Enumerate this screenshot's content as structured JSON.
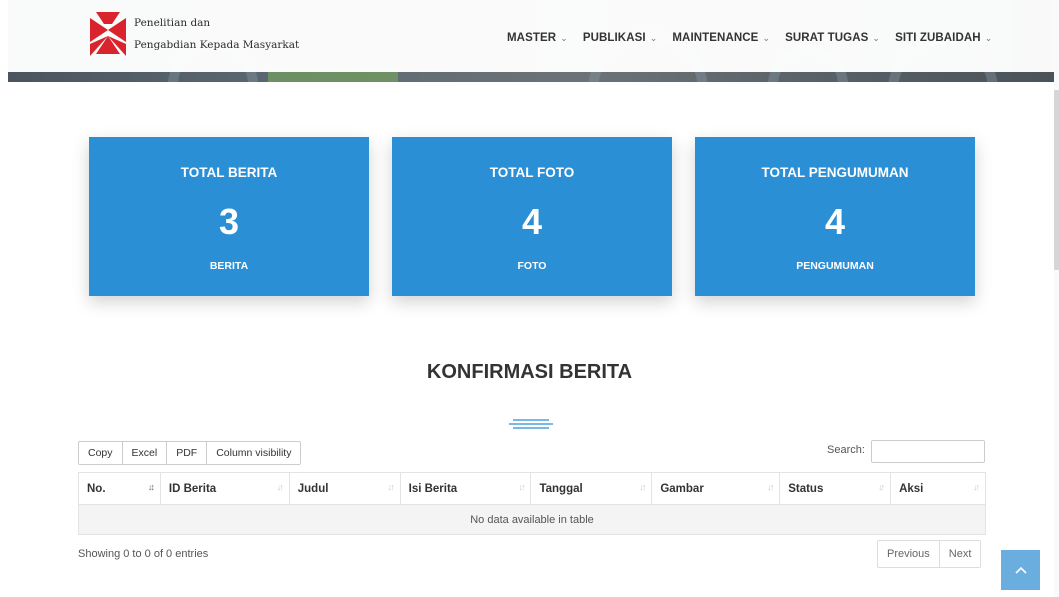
{
  "brand": {
    "line1": "Penelitian dan",
    "line2": "Pengabdian Kepada Masyarkat",
    "colors": {
      "red": "#d9232d",
      "white": "#ffffff"
    }
  },
  "nav": {
    "items": [
      {
        "label": "MASTER",
        "icon": "chevron-down-icon"
      },
      {
        "label": "PUBLIKASI",
        "icon": "chevron-down-icon"
      },
      {
        "label": "MAINTENANCE",
        "icon": "chevron-down-icon"
      },
      {
        "label": "SURAT TUGAS",
        "icon": "chevron-down-icon"
      },
      {
        "label": "SITI ZUBAIDAH",
        "icon": "chevron-down-icon"
      }
    ],
    "chevron": "⌄"
  },
  "stats": [
    {
      "title": "TOTAL BERITA",
      "value": "3",
      "unit": "BERITA"
    },
    {
      "title": "TOTAL FOTO",
      "value": "4",
      "unit": "FOTO"
    },
    {
      "title": "TOTAL PENGUMUMAN",
      "value": "4",
      "unit": "PENGUMUMAN"
    }
  ],
  "accent_color": "#2b8fd6",
  "section": {
    "title": "KONFIRMASI BERITA",
    "divider_icon": "triple-line-divider-icon"
  },
  "table_tools": {
    "buttons": [
      "Copy",
      "Excel",
      "PDF",
      "Column visibility"
    ],
    "search_label": "Search:",
    "search_value": ""
  },
  "table": {
    "columns": [
      "No.",
      "ID Berita",
      "Judul",
      "Isi Berita",
      "Tanggal",
      "Gambar",
      "Status",
      "Aksi"
    ],
    "sort_icon": "sort-arrows-icon",
    "empty_message": "No data available in table"
  },
  "footer": {
    "info": "Showing 0 to 0 of 0 entries",
    "prev": "Previous",
    "next": "Next"
  },
  "back_to_top_icon": "chevron-up-icon"
}
